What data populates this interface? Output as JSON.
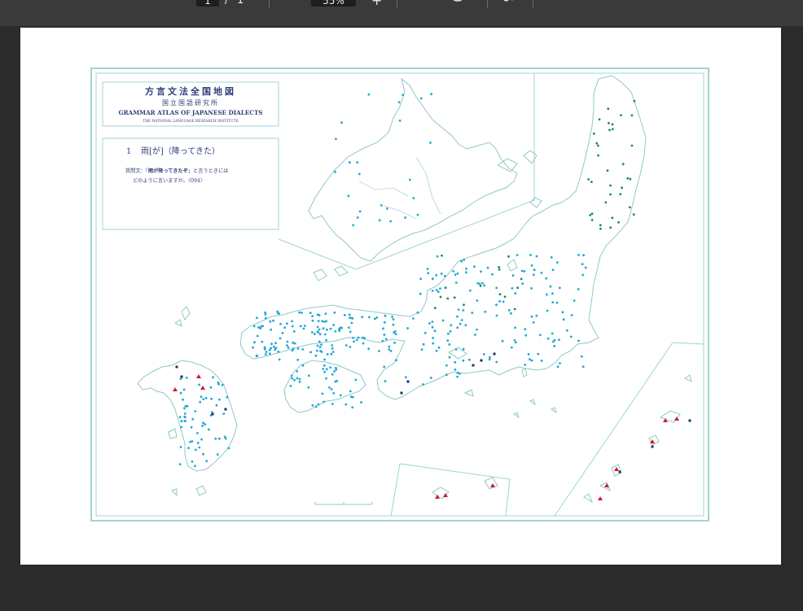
{
  "toolbar": {
    "page_current": "1",
    "page_separator": "/",
    "page_total": "1",
    "zoom": "55%",
    "zoom_in_label": "+"
  },
  "map": {
    "title_jp": "方言文法全国地図",
    "institute_jp": "国立国語研究所",
    "title_en": "GRAMMAR ATLAS OF JAPANESE DIALECTS",
    "institute_en": "THE NATIONAL LANGUAGE RESEARCH INSTITUTE",
    "item_number": "1",
    "item_title": "雨[が]（降ってきた）",
    "question_prefix": "質問文：「",
    "question_bold": "雨が降ってきたぞ",
    "question_suffix": "」と言うときには",
    "question_line2": "どのように言いますか。〈094〉"
  },
  "colors": {
    "border": "#9fd5d0",
    "coast": "#8fc9c4",
    "dot_cyan": "#1ea8d4",
    "dot_green": "#1a8a5c",
    "marker_red": "#c81e2d",
    "marker_navy": "#1b2f6b"
  }
}
